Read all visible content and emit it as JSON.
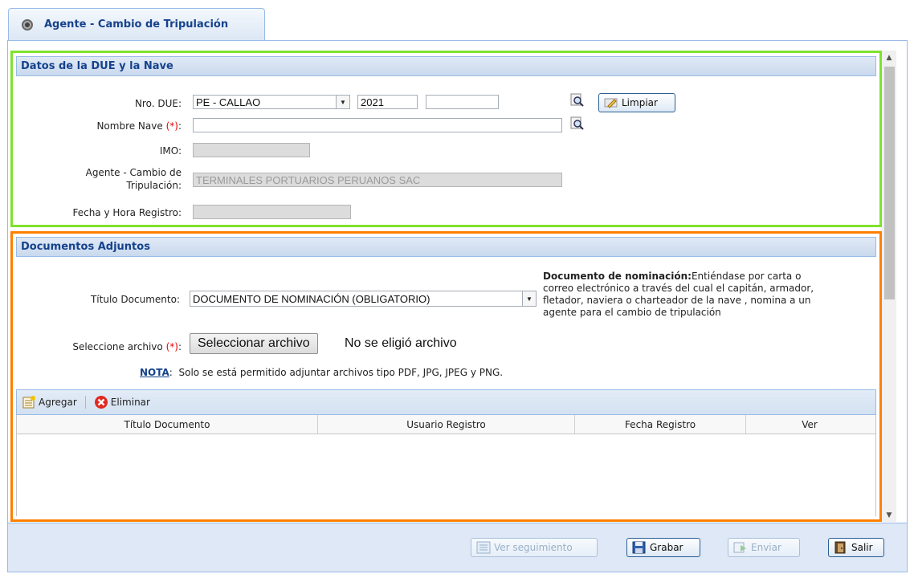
{
  "tab": {
    "title": "Agente - Cambio de Tripulación"
  },
  "section1": {
    "header": "Datos de la DUE y la Nave",
    "nro_due": {
      "label": "Nro. DUE:",
      "port": "PE - CALLAO",
      "year": "2021",
      "number": ""
    },
    "limpiar_label": "Limpiar",
    "nombre_nave": {
      "label": "Nombre Nave",
      "required": "(*)",
      "colon": ":",
      "value": ""
    },
    "imo": {
      "label": "IMO:",
      "value": ""
    },
    "agente": {
      "label_line1": "Agente - Cambio de",
      "label_line2": "Tripulación:",
      "value": "TERMINALES PORTUARIOS PERUANOS SAC"
    },
    "fecha": {
      "label": "Fecha y Hora Registro:",
      "value": ""
    }
  },
  "section2": {
    "header": "Documentos Adjuntos",
    "titulo_doc": {
      "label": "Título Documento:",
      "value": "DOCUMENTO DE NOMINACIÓN (OBLIGATORIO)"
    },
    "note": {
      "title": "Documento de nominación:",
      "line1": "Entiéndase por carta o",
      "line2": "correo electrónico a través del cual el capitán, armador,",
      "line3": "fletador, naviera o charteador de la nave , nomina a un",
      "line4": "agente para el cambio de tripulación"
    },
    "archivo": {
      "label": "Seleccione archivo",
      "required": "(*)",
      "colon": ":",
      "button": "Seleccionar archivo",
      "status": "No se eligió archivo"
    },
    "nota": {
      "label": "NOTA",
      "text": "Solo se está permitido adjuntar archivos tipo PDF, JPG, JPEG y PNG."
    },
    "toolbar": {
      "agregar": "Agregar",
      "eliminar": "Eliminar"
    },
    "grid_columns": [
      "Título Documento",
      "Usuario Registro",
      "Fecha Registro",
      "Ver"
    ]
  },
  "footer": {
    "ver_seguimiento": "Ver seguimiento",
    "grabar": "Grabar",
    "enviar": "Enviar",
    "salir": "Salir"
  }
}
